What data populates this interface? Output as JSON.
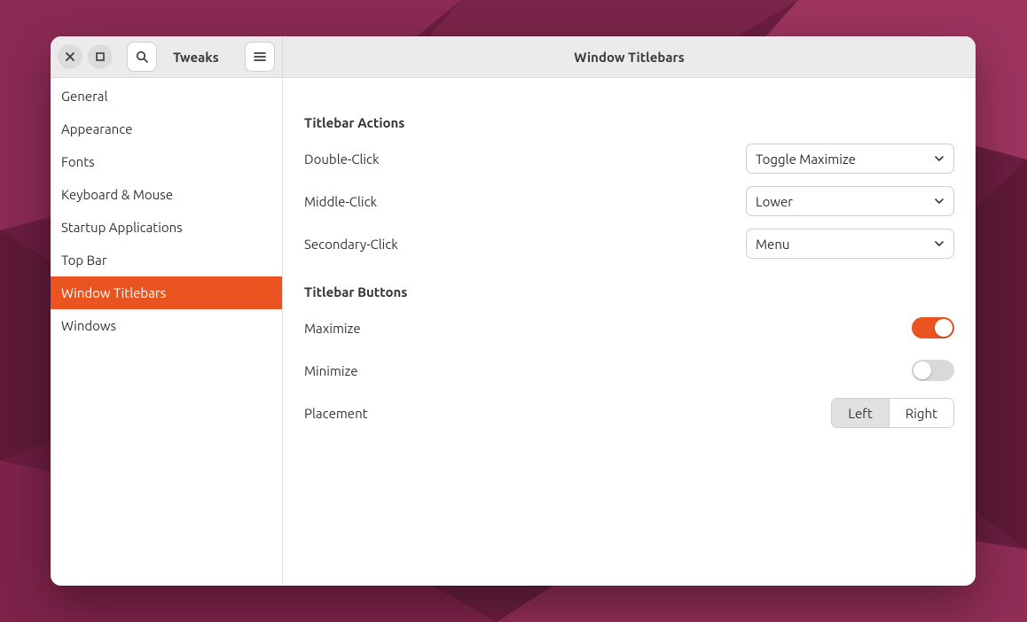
{
  "header": {
    "app_title": "Tweaks",
    "page_title": "Window Titlebars"
  },
  "sidebar": {
    "items": [
      {
        "label": "General",
        "active": false
      },
      {
        "label": "Appearance",
        "active": false
      },
      {
        "label": "Fonts",
        "active": false
      },
      {
        "label": "Keyboard & Mouse",
        "active": false
      },
      {
        "label": "Startup Applications",
        "active": false
      },
      {
        "label": "Top Bar",
        "active": false
      },
      {
        "label": "Window Titlebars",
        "active": true
      },
      {
        "label": "Windows",
        "active": false
      }
    ]
  },
  "sections": {
    "actions": {
      "title": "Titlebar Actions",
      "double_click": {
        "label": "Double-Click",
        "value": "Toggle Maximize"
      },
      "middle_click": {
        "label": "Middle-Click",
        "value": "Lower"
      },
      "secondary_click": {
        "label": "Secondary-Click",
        "value": "Menu"
      }
    },
    "buttons": {
      "title": "Titlebar Buttons",
      "maximize": {
        "label": "Maximize",
        "on": true
      },
      "minimize": {
        "label": "Minimize",
        "on": false
      },
      "placement": {
        "label": "Placement",
        "options": {
          "left": "Left",
          "right": "Right"
        },
        "selected": "left"
      }
    }
  },
  "colors": {
    "accent": "#e95420"
  }
}
